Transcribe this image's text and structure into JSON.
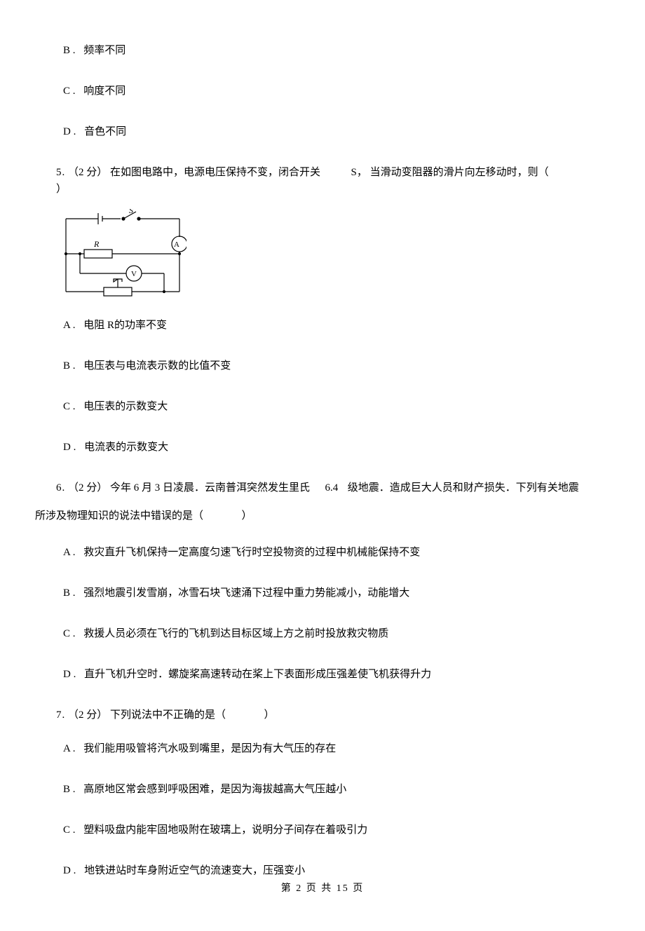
{
  "prev_options": {
    "b": {
      "label": "B .",
      "text": "频率不同"
    },
    "c": {
      "label": "C .",
      "text": "响度不同"
    },
    "d": {
      "label": "D .",
      "text": "音色不同"
    }
  },
  "q5": {
    "num": "5.",
    "points": "（2 分）",
    "text_a": "在如图电路中，电源电压保持不变，闭合开关",
    "switch": "S，",
    "text_b": "当滑动变阻器的滑片向左移动时，则（",
    "close": "）",
    "circuit": {
      "S": "S",
      "R": "R",
      "A": "A",
      "V": "V"
    },
    "options": {
      "a": {
        "label": "A .",
        "text": "电阻 R的功率不变"
      },
      "b": {
        "label": "B .",
        "text": "电压表与电流表示数的比值不变"
      },
      "c": {
        "label": "C .",
        "text": "电压表的示数变大"
      },
      "d": {
        "label": "D .",
        "text": "电流表的示数变大"
      }
    }
  },
  "q6": {
    "num": "6.",
    "points": "（2 分）",
    "text_a": "今年 6 月 3 日凌晨．云南普洱突然发生里氏",
    "mag": "6.4",
    "text_b": "级地震．造成巨大人员和财产损失．下列有关地震",
    "cont": "所涉及物理知识的说法中错误的是（",
    "close": "）",
    "options": {
      "a": {
        "label": "A .",
        "text": "救灾直升飞机保持一定高度匀速飞行时空投物资的过程中机械能保持不变"
      },
      "b": {
        "label": "B .",
        "text": "强烈地震引发雪崩，冰雪石块飞速涌下过程中重力势能减小，动能增大"
      },
      "c": {
        "label": "C .",
        "text": "救援人员必须在飞行的飞机到达目标区域上方之前时投放救灾物质"
      },
      "d": {
        "label": "D .",
        "text": "直升飞机升空时．螺旋桨高速转动在桨上下表面形成压强差使飞机获得升力"
      }
    }
  },
  "q7": {
    "num": "7.",
    "points": "（2 分）",
    "text": "下列说法中不正确的是（",
    "close": "）",
    "options": {
      "a": {
        "label": "A .",
        "text": "我们能用吸管将汽水吸到嘴里，是因为有大气压的存在"
      },
      "b": {
        "label": "B .",
        "text": "高原地区常会感到呼吸困难，是因为海拔越高大气压越小"
      },
      "c": {
        "label": "C .",
        "text": "塑料吸盘内能牢固地吸附在玻璃上，说明分子间存在着吸引力"
      },
      "d": {
        "label": "D .",
        "text": "地铁进站时车身附近空气的流速变大，压强变小"
      }
    }
  },
  "footer": "第 2 页 共 15 页"
}
